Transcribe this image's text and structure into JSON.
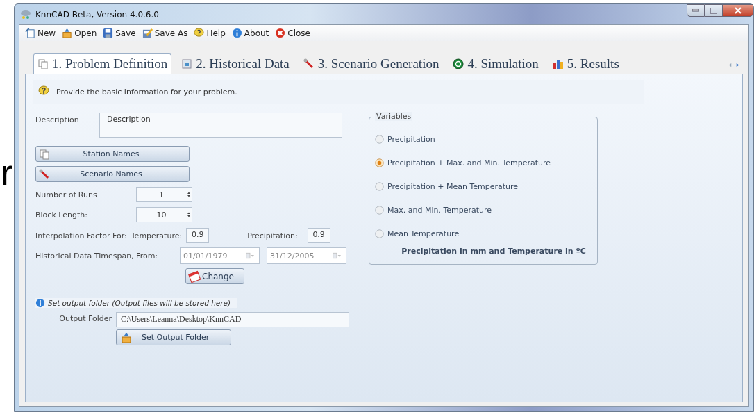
{
  "background_text": "r",
  "window": {
    "title": "KnnCAD Beta, Version 4.0.6.0"
  },
  "toolbar": [
    {
      "kind": "new",
      "label": "New"
    },
    {
      "kind": "open",
      "label": "Open"
    },
    {
      "kind": "save",
      "label": "Save"
    },
    {
      "kind": "saveas",
      "label": "Save As"
    },
    {
      "kind": "help",
      "label": "Help"
    },
    {
      "kind": "about",
      "label": "About"
    },
    {
      "kind": "close",
      "label": "Close"
    }
  ],
  "tabs": [
    {
      "kind": "pages",
      "label": "1. Problem Definition",
      "selected": true
    },
    {
      "kind": "data",
      "label": "2. Historical Data",
      "selected": false
    },
    {
      "kind": "wrench",
      "label": "3. Scenario Generation",
      "selected": false
    },
    {
      "kind": "go",
      "label": "4. Simulation",
      "selected": false
    },
    {
      "kind": "chart",
      "label": "5. Results",
      "selected": false
    }
  ],
  "info": "Provide the basic information for your problem.",
  "description": {
    "label": "Description",
    "value": "Description"
  },
  "name_buttons": [
    {
      "kind": "pages",
      "label": "Station Names"
    },
    {
      "kind": "wrench",
      "label": "Scenario Names"
    }
  ],
  "spinners": [
    {
      "label": "Number of Runs",
      "value": "1"
    },
    {
      "label": "Block Length:",
      "value": "10"
    }
  ],
  "interpolation": {
    "label": "Interpolation Factor For:",
    "temperature_label": "Temperature:",
    "temperature": "0.9",
    "precipitation_label": "Precipitation:",
    "precipitation": "0.9"
  },
  "timespan": {
    "label": "Historical Data Timespan, From:",
    "from": "01/01/1979",
    "to": "31/12/2005",
    "button": "Change"
  },
  "output": {
    "hint": "Set output folder (Output files will be stored here)",
    "label": "Output Folder",
    "value": "C:\\Users\\Leanna\\Desktop\\KnnCAD",
    "button": "Set Output Folder"
  },
  "variables": {
    "title": "Variables",
    "options": [
      {
        "label": "Precipitation",
        "selected": false
      },
      {
        "label": "Precipitation + Max. and Min. Temperature",
        "selected": true
      },
      {
        "label": "Precipitation + Mean Temperature",
        "selected": false
      },
      {
        "label": "Max. and Min. Temperature",
        "selected": false
      },
      {
        "label": "Mean Temperature",
        "selected": false
      }
    ],
    "note": "Precipitation in mm and Temperature in ºC"
  }
}
